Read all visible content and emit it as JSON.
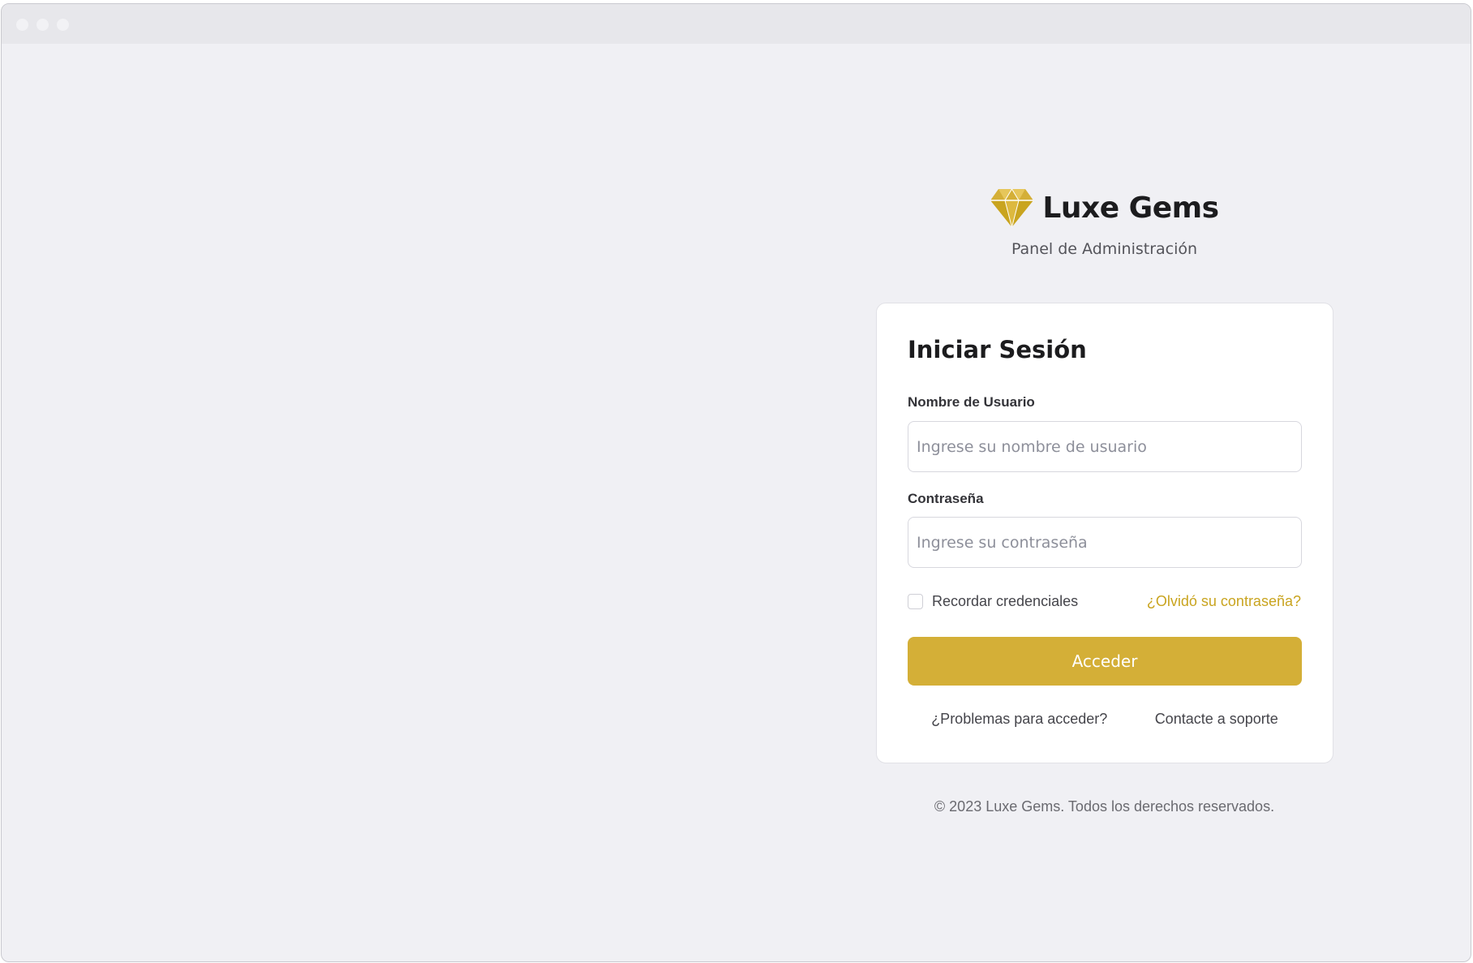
{
  "brand": {
    "name": "Luxe Gems",
    "subtitle": "Panel de Administración",
    "accent_color": "#D4AF37",
    "logo_icon": "diamond-icon"
  },
  "login": {
    "title": "Iniciar Sesión",
    "username_label": "Nombre de Usuario",
    "username_placeholder": "Ingrese su nombre de usuario",
    "username_value": "",
    "password_label": "Contraseña",
    "password_placeholder": "Ingrese su contraseña",
    "password_value": "",
    "remember_label": "Recordar credenciales",
    "remember_checked": false,
    "forgot_link": "¿Olvidó su contraseña?",
    "submit_label": "Acceder",
    "help_link": "¿Problemas para acceder?",
    "support_link": "Contacte a soporte"
  },
  "footer": {
    "copyright": "© 2023 Luxe Gems. Todos los derechos reservados."
  }
}
